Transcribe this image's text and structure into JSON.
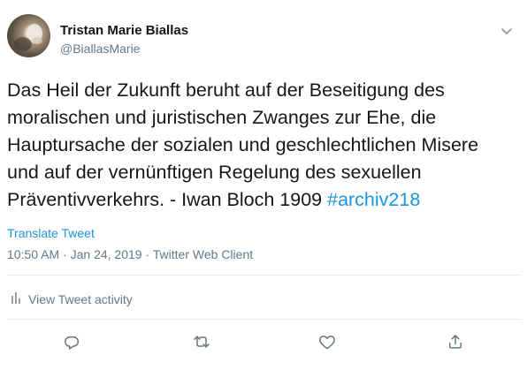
{
  "tweet": {
    "author": {
      "display_name": "Tristan Marie Biallas",
      "handle": "@BiallasMarie"
    },
    "text": "Das Heil der Zukunft beruht auf der Beseitigung des moralischen und juristischen Zwanges zur Ehe, die Hauptursache der sozialen und geschlechtlichen Misere und auf der vernünftigen Regelung des sexuellen Präventivverkehrs. - Iwan Bloch 1909",
    "hashtag": "#archiv218",
    "translate_label": "Translate Tweet",
    "time": "10:50 AM",
    "date": "Jan 24, 2019",
    "separator": "·",
    "client": "Twitter Web Client",
    "activity_label": "View Tweet activity"
  },
  "icons": {
    "more": "chevron-down-icon",
    "activity": "bar-chart-icon",
    "reply": "reply-icon",
    "retweet": "retweet-icon",
    "like": "heart-icon",
    "share": "share-icon"
  },
  "colors": {
    "text": "#14171a",
    "secondary": "#657786",
    "link": "#1b95e0",
    "divider": "#e6ecf0"
  }
}
